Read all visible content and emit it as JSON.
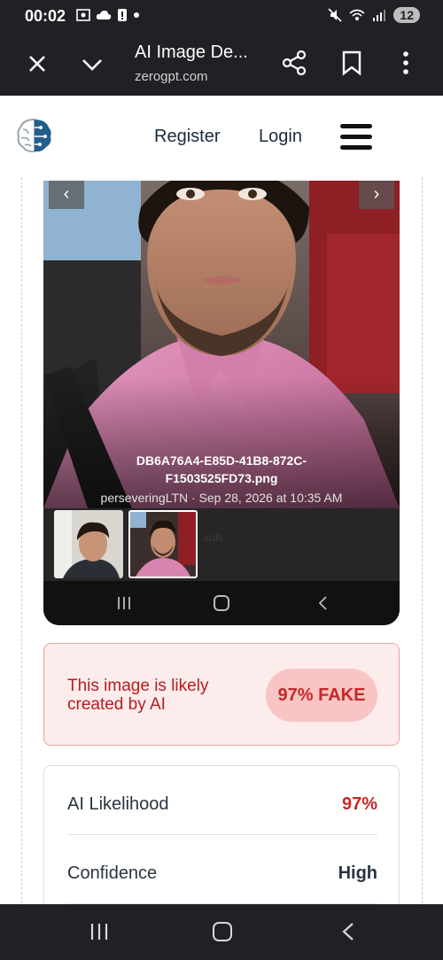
{
  "status_bar": {
    "time": "00:02",
    "battery": "12",
    "left_icons": [
      "screenshot-icon",
      "cloud-icon",
      "alert-icon",
      "dot-icon"
    ],
    "right_icons": [
      "mute-icon",
      "wifi-icon",
      "signal-icon"
    ]
  },
  "browser": {
    "title": "AI Image De...",
    "url": "zerogpt.com"
  },
  "site_nav": {
    "register": "Register",
    "login": "Login"
  },
  "viewer": {
    "filename_line1": "DB6A76A4-E85D-41B8-872C-",
    "filename_line2": "F1503525FD73.png",
    "meta": "perseveringLTN · Sep 28, 2026 at 10:35 AM",
    "prev_glyph": "‹",
    "next_glyph": "›",
    "ghost_text": "ardk"
  },
  "verdict": {
    "text": "This image is likely created by AI",
    "badge": "97% FAKE"
  },
  "stats": [
    {
      "label": "AI Likelihood",
      "value": "97%"
    },
    {
      "label": "Confidence",
      "value": "High"
    }
  ],
  "colors": {
    "fake_red": "#c62828",
    "verdict_bg": "#fdecec",
    "dark_bar": "#202124"
  }
}
